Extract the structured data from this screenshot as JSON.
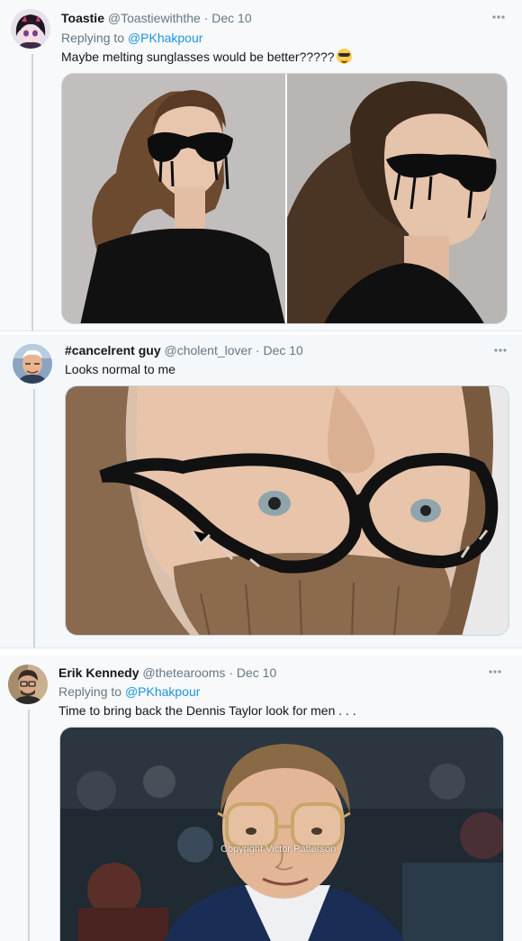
{
  "tweets": [
    {
      "name": "Toastie",
      "handle": "@Toastiewiththe",
      "dot": "·",
      "date": "Dec 10",
      "reply_prefix": "Replying to",
      "reply_to": "@PKhakpour",
      "text": "Maybe melting sunglasses would be better?????",
      "emoji": "sunglasses-face",
      "media": "runway photos of model in dripping black sunglasses"
    },
    {
      "name": "#cancelrent guy",
      "handle": "@cholent_lover",
      "dot": "·",
      "date": "Dec 10",
      "text": "Looks normal to me",
      "media": "close-up of upside-down black cat-eye glasses"
    },
    {
      "name": "Erik Kennedy",
      "handle": "@thetearooms",
      "dot": "·",
      "date": "Dec 10",
      "reply_prefix": "Replying to",
      "reply_to": "@PKhakpour",
      "text": "Time to bring back the Dennis Taylor look for men . . .",
      "media": "photo of man in oversized upside-down glasses",
      "watermark": "Copyright Victor Patterson"
    }
  ],
  "more_icon": "more-horizontal-icon"
}
